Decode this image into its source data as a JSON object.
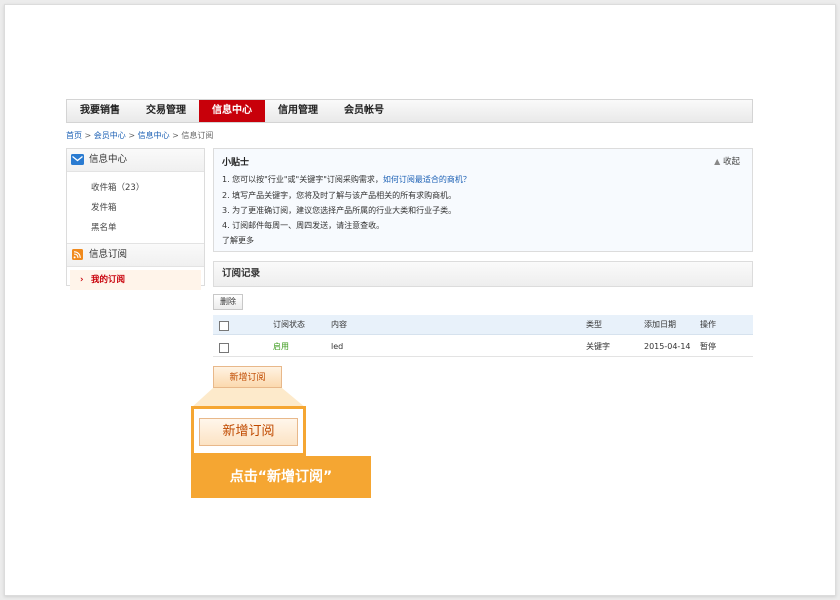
{
  "nav": {
    "tabs": [
      {
        "label": "我要销售"
      },
      {
        "label": "交易管理"
      },
      {
        "label": "信息中心"
      },
      {
        "label": "信用管理"
      },
      {
        "label": "会员帐号"
      }
    ],
    "active_index": 2
  },
  "breadcrumb": {
    "home": "首页",
    "member": "会员中心",
    "info": "信息中心",
    "current": "信息订阅",
    "sep": ">"
  },
  "sidebar": {
    "group1": {
      "title": "信息中心",
      "icon": "mail-icon",
      "items": [
        "收件箱（23）",
        "发件箱",
        "黑名单"
      ]
    },
    "group2": {
      "title": "信息订阅",
      "icon": "rss-icon",
      "active_item": "我的订阅"
    }
  },
  "tips": {
    "title": "小贴士",
    "collapse": "收起",
    "line1_text": "1. 您可以按\"行业\"或\"关键字\"订阅采购需求，",
    "line1_link": "如何订阅最适合的商机？",
    "line2": "2. 填写产品关键字，您将及时了解与该产品相关的所有求购商机。",
    "line3": "3. 为了更准确订阅，建议您选择产品所属的行业大类和行业子类。",
    "line4": "4. 订阅邮件每周一、周四发送，请注意查收。",
    "more": "了解更多"
  },
  "records": {
    "title": "订阅记录",
    "delete_label": "删除",
    "columns": {
      "status": "订阅状态",
      "content": "内容",
      "type": "类型",
      "date": "添加日期",
      "action": "操作"
    },
    "rows": [
      {
        "status": "启用",
        "content": "led",
        "type": "关键字",
        "date": "2015-04-14",
        "action": "暂停"
      }
    ],
    "add_label": "新增订阅"
  },
  "callout": {
    "button_label": "新增订阅",
    "banner": "点击“新增订阅”"
  },
  "colors": {
    "brand_red": "#c8000a",
    "accent_orange": "#f5a632",
    "link_blue": "#1a5fb4",
    "status_green": "#3a9a1a"
  }
}
